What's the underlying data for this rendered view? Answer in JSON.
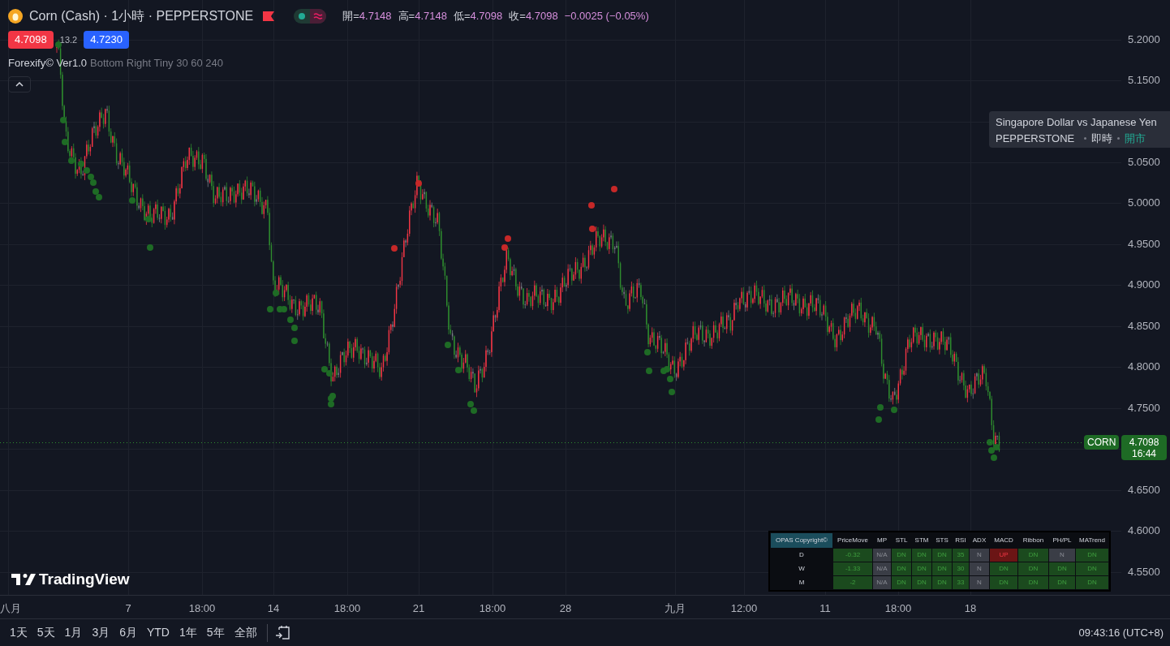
{
  "legend": {
    "title": "Corn (Cash) · 1小時 · PEPPERSTONE",
    "ohlc": [
      {
        "label": "開=",
        "value": "4.7148"
      },
      {
        "label": "高=",
        "value": "4.7148"
      },
      {
        "label": "低=",
        "value": "4.7098"
      },
      {
        "label": "收=",
        "value": "4.7098"
      }
    ],
    "change": "−0.0025 (−0.05%)",
    "bid": "4.7098",
    "spread": "13.2",
    "ask": "4.7230",
    "indicator": {
      "name": "Forexify© Ver1.0",
      "params": "Bottom Right Tiny 30 60 240"
    }
  },
  "tooltip": {
    "title": "Singapore Dollar vs Japanese Yen",
    "exchange": "PEPPERSTONE",
    "delay": "即時",
    "status": "開市"
  },
  "price_axis": [
    "5.2000",
    "5.1500",
    "5.0500",
    "5.0000",
    "4.9500",
    "4.9000",
    "4.8500",
    "4.8000",
    "4.7500",
    "4.6500",
    "4.6000",
    "4.5500"
  ],
  "time_axis": [
    "八月",
    "7",
    "18:00",
    "14",
    "18:00",
    "21",
    "18:00",
    "28",
    "九月",
    "12:00",
    "11",
    "18:00",
    "18"
  ],
  "last_price": {
    "symbol": "CORN",
    "price": "4.7098",
    "countdown": "16:44"
  },
  "table": {
    "header": [
      "OPAS Copyright©",
      "PriceMove",
      "MP",
      "STL",
      "STM",
      "STS",
      "RSI",
      "ADX",
      "MACD",
      "Ribbon",
      "PH/PL",
      "MATrend"
    ],
    "rows": [
      {
        "label": "D",
        "cells": [
          {
            "text": "-0.32",
            "kind": "bull"
          },
          {
            "text": "N/A",
            "kind": "neutral"
          },
          {
            "text": "DN",
            "kind": "bull"
          },
          {
            "text": "DN",
            "kind": "bull"
          },
          {
            "text": "DN",
            "kind": "bull"
          },
          {
            "text": "35",
            "kind": "bull"
          },
          {
            "text": "N",
            "kind": "neutral"
          },
          {
            "text": "UP",
            "kind": "bear"
          },
          {
            "text": "DN",
            "kind": "bull"
          },
          {
            "text": "N",
            "kind": "neutral"
          },
          {
            "text": "DN",
            "kind": "bull"
          }
        ]
      },
      {
        "label": "W",
        "cells": [
          {
            "text": "-1.33",
            "kind": "bull"
          },
          {
            "text": "N/A",
            "kind": "neutral"
          },
          {
            "text": "DN",
            "kind": "bull"
          },
          {
            "text": "DN",
            "kind": "bull"
          },
          {
            "text": "DN",
            "kind": "bull"
          },
          {
            "text": "30",
            "kind": "bull"
          },
          {
            "text": "N",
            "kind": "neutral"
          },
          {
            "text": "DN",
            "kind": "bull"
          },
          {
            "text": "DN",
            "kind": "bull"
          },
          {
            "text": "DN",
            "kind": "bull"
          },
          {
            "text": "DN",
            "kind": "bull"
          }
        ]
      },
      {
        "label": "M",
        "cells": [
          {
            "text": "-2",
            "kind": "bull"
          },
          {
            "text": "N/A",
            "kind": "neutral"
          },
          {
            "text": "DN",
            "kind": "bull"
          },
          {
            "text": "DN",
            "kind": "bull"
          },
          {
            "text": "DN",
            "kind": "bull"
          },
          {
            "text": "33",
            "kind": "bull"
          },
          {
            "text": "N",
            "kind": "neutral"
          },
          {
            "text": "DN",
            "kind": "bull"
          },
          {
            "text": "DN",
            "kind": "bull"
          },
          {
            "text": "DN",
            "kind": "bull"
          },
          {
            "text": "DN",
            "kind": "bull"
          }
        ]
      }
    ]
  },
  "brand": "TradingView",
  "ranges": [
    "1天",
    "5天",
    "1月",
    "3月",
    "6月",
    "YTD",
    "1年",
    "5年",
    "全部"
  ],
  "clock": "09:43:16 (UTC+8)"
}
